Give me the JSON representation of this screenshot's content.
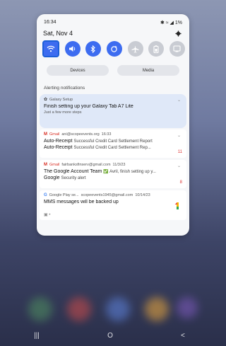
{
  "status": {
    "time": "16:34",
    "icons": "✱ ≈ ◢ 1%"
  },
  "date": "Sat, Nov 4",
  "quick_settings": [
    {
      "name": "wifi",
      "icon": "wifi-icon",
      "on": true
    },
    {
      "name": "sound",
      "icon": "speaker-icon",
      "on": true
    },
    {
      "name": "bluetooth",
      "icon": "bluetooth-icon",
      "on": true
    },
    {
      "name": "auto-rotate",
      "icon": "rotate-icon",
      "on": true
    },
    {
      "name": "airplane",
      "icon": "airplane-icon",
      "on": false
    },
    {
      "name": "battery-saver",
      "icon": "battery-icon",
      "on": false
    },
    {
      "name": "cast",
      "icon": "cast-icon",
      "on": false
    }
  ],
  "pills": {
    "devices": "Devices",
    "media": "Media"
  },
  "section": "Alerting notifications",
  "notifications": {
    "galaxy": {
      "app": "Galaxy Setup",
      "title": "Finish setting up your Galaxy Tab A7 Lite",
      "sub": "Just a few more steps"
    },
    "gmail1": {
      "app": "Gmail",
      "account": "ani@scopeevents.org",
      "time": "16:33",
      "row1_bold": "Auto-Receipt",
      "row1_rest": "Successful Credit Card Settlement Report",
      "row2_bold": "Auto-Receipt",
      "row2_rest": "Successful Credit Card Settlement Rep...",
      "count": "11"
    },
    "gmail2": {
      "app": "Gmail",
      "account": "fairbanksfinserv@gmail.com",
      "time": "11/3/23",
      "row1_bold": "The Google Account Team",
      "row1_rest": "✅ Avril, finish setting up y...",
      "row2_bold": "Google",
      "row2_rest": "Security alert",
      "count": "8"
    },
    "play": {
      "app": "Google Play se...",
      "account": "scopeevents1945@gmail.com",
      "time": "10/14/23",
      "title": "MMS messages will be backed up"
    }
  },
  "nav": {
    "recents": "|||",
    "home": "O",
    "back": "<"
  },
  "colors": {
    "accent": "#3d6cf0",
    "wifi_outline": "#1c5fd8",
    "gmail": "#d93025"
  }
}
